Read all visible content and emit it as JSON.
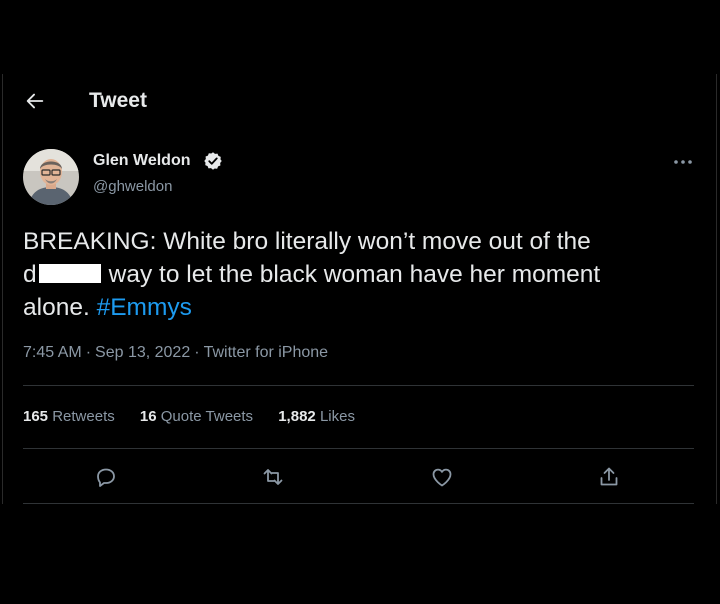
{
  "header": {
    "title": "Tweet",
    "back_icon": "arrow-left-icon"
  },
  "tweet": {
    "author": {
      "name": "Glen Weldon",
      "handle": "@ghweldon",
      "verified": true
    },
    "text": {
      "line1": "BREAKING: White bro literally won’t move out of the",
      "line2_prefix": "d",
      "line2_rest": "way to let the black woman have her moment",
      "line3_prefix": "alone.",
      "hashtag": "#Emmys"
    },
    "meta": {
      "time": "7:45 AM",
      "separator": "·",
      "date": "Sep 13, 2022",
      "source": "Twitter for iPhone"
    },
    "stats": {
      "retweets_count": "165",
      "retweets_label": "Retweets",
      "quotes_count": "16",
      "quotes_label": "Quote Tweets",
      "likes_count": "1,882",
      "likes_label": "Likes"
    },
    "actions": [
      "reply-icon",
      "retweet-icon",
      "like-icon",
      "share-icon"
    ]
  },
  "colors": {
    "background": "#000000",
    "text": "#e7e9ea",
    "muted": "#8b98a5",
    "accent": "#1d9bf0",
    "divider": "#2f3336"
  }
}
